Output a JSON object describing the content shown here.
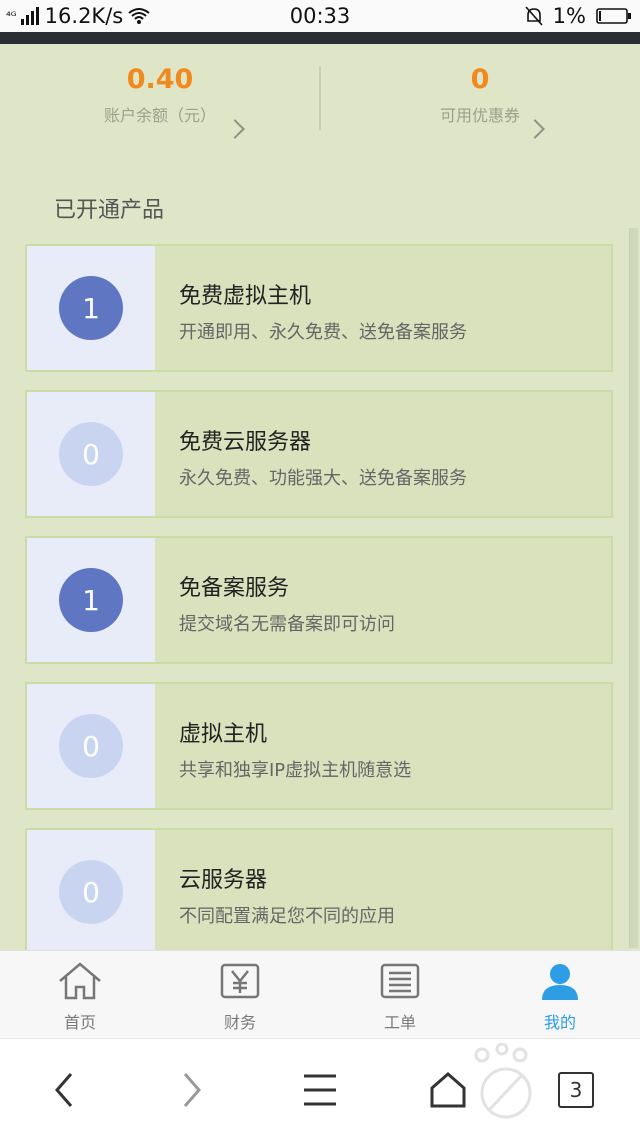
{
  "status_bar": {
    "network": "⁴ᴳ",
    "speed": "16.2K/s",
    "time": "00:33",
    "battery": "1%"
  },
  "account": {
    "balance_value": "0.40",
    "balance_label": "账户余额（元）",
    "coupons_value": "0",
    "coupons_label": "可用优惠券"
  },
  "section_title": "已开通产品",
  "products": [
    {
      "count": "1",
      "title": "免费虚拟主机",
      "desc": "开通即用、永久免费、送免备案服务"
    },
    {
      "count": "0",
      "title": "免费云服务器",
      "desc": "永久免费、功能强大、送免备案服务"
    },
    {
      "count": "1",
      "title": "免备案服务",
      "desc": "提交域名无需备案即可访问"
    },
    {
      "count": "0",
      "title": "虚拟主机",
      "desc": "共享和独享IP虚拟主机随意选"
    },
    {
      "count": "0",
      "title": "云服务器",
      "desc": "不同配置满足您不同的应用"
    }
  ],
  "tabbar": [
    {
      "label": "首页",
      "icon": "home-icon"
    },
    {
      "label": "财务",
      "icon": "yen-icon"
    },
    {
      "label": "工单",
      "icon": "ticket-icon"
    },
    {
      "label": "我的",
      "icon": "user-icon"
    }
  ],
  "browser": {
    "tab_count": "3"
  },
  "colors": {
    "accent_orange": "#f08a1d",
    "active_blue": "#2d9de6",
    "badge_active": "#5f76c2",
    "badge_inactive": "#c9d5f0",
    "app_bg": "#dfe6c8"
  }
}
